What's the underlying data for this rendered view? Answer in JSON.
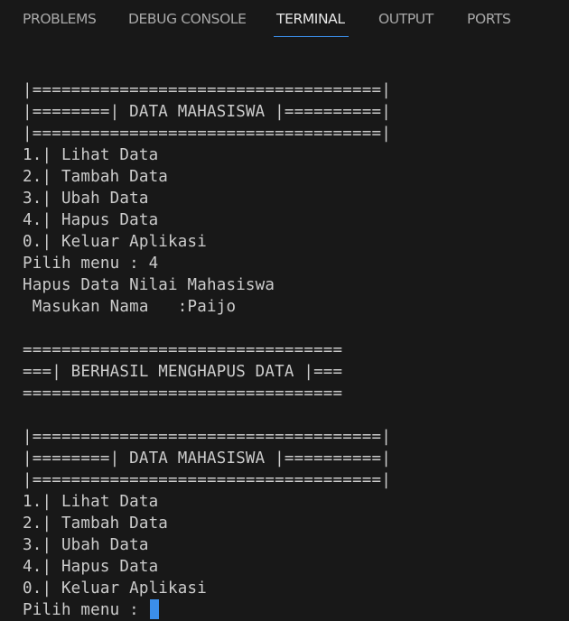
{
  "panel": {
    "tabs": [
      {
        "label": "PROBLEMS"
      },
      {
        "label": "DEBUG CONSOLE"
      },
      {
        "label": "TERMINAL"
      },
      {
        "label": "OUTPUT"
      },
      {
        "label": "PORTS"
      }
    ],
    "active_tab": "TERMINAL"
  },
  "terminal": {
    "lines": [
      "|====================================|",
      "|========| DATA MAHASISWA |==========|",
      "|====================================|",
      "1.| Lihat Data",
      "2.| Tambah Data",
      "3.| Ubah Data",
      "4.| Hapus Data",
      "0.| Keluar Aplikasi",
      "Pilih menu : 4",
      "Hapus Data Nilai Mahasiswa",
      " Masukan Nama   :Paijo",
      "",
      "=================================",
      "===| BERHASIL MENGHAPUS DATA |===",
      "=================================",
      "",
      "|====================================|",
      "|========| DATA MAHASISWA |==========|",
      "|====================================|",
      "1.| Lihat Data",
      "2.| Tambah Data",
      "3.| Ubah Data",
      "4.| Hapus Data",
      "0.| Keluar Aplikasi",
      "Pilih menu : "
    ],
    "cursor_color": "#3b8eea"
  },
  "colors": {
    "background": "#181818",
    "text": "#cccccc",
    "tab_inactive": "#a8a8a8",
    "tab_active": "#e6e6e6",
    "accent": "#3b8eea"
  }
}
